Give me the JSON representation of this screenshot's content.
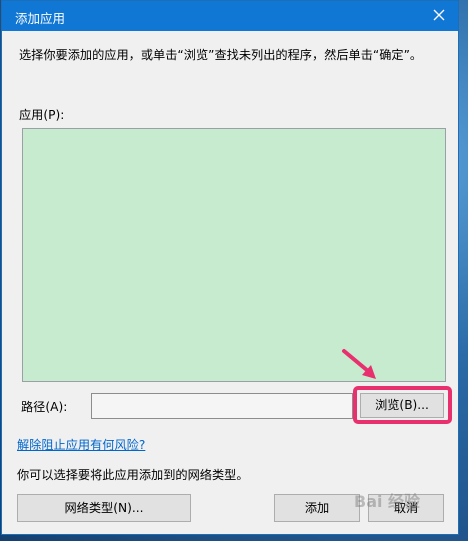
{
  "window": {
    "title": "添加应用",
    "close_icon": "close-icon"
  },
  "dialog": {
    "instruction": "选择你要添加的应用，或单击“浏览”查找未列出的程序，然后单击“确定”。",
    "apps_label": "应用(P):",
    "path_label": "路径(A):",
    "path_value": "",
    "browse_label": "浏览(B)...",
    "risk_link": "解除阻止应用有何风险?",
    "network_text": "你可以选择要将此应用添加到的网络类型。",
    "network_button": "网络类型(N)...",
    "add_button": "添加",
    "cancel_button": "取消"
  },
  "annotation": {
    "arrow_icon": "pointer-arrow-icon",
    "highlight_color": "#e8306f"
  },
  "watermark": "Bai 经验",
  "colors": {
    "titlebar": "#1177d4",
    "list_background": "#c6ebcf",
    "link": "#0066cc"
  }
}
